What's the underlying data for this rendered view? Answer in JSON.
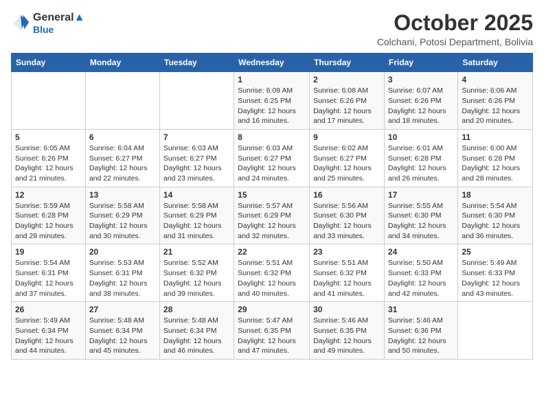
{
  "logo": {
    "line1": "General",
    "line2": "Blue"
  },
  "title": "October 2025",
  "location": "Colchani, Potosi Department, Bolivia",
  "days_of_week": [
    "Sunday",
    "Monday",
    "Tuesday",
    "Wednesday",
    "Thursday",
    "Friday",
    "Saturday"
  ],
  "weeks": [
    [
      {
        "day": "",
        "info": ""
      },
      {
        "day": "",
        "info": ""
      },
      {
        "day": "",
        "info": ""
      },
      {
        "day": "1",
        "info": "Sunrise: 6:09 AM\nSunset: 6:25 PM\nDaylight: 12 hours\nand 16 minutes."
      },
      {
        "day": "2",
        "info": "Sunrise: 6:08 AM\nSunset: 6:26 PM\nDaylight: 12 hours\nand 17 minutes."
      },
      {
        "day": "3",
        "info": "Sunrise: 6:07 AM\nSunset: 6:26 PM\nDaylight: 12 hours\nand 18 minutes."
      },
      {
        "day": "4",
        "info": "Sunrise: 6:06 AM\nSunset: 6:26 PM\nDaylight: 12 hours\nand 20 minutes."
      }
    ],
    [
      {
        "day": "5",
        "info": "Sunrise: 6:05 AM\nSunset: 6:26 PM\nDaylight: 12 hours\nand 21 minutes."
      },
      {
        "day": "6",
        "info": "Sunrise: 6:04 AM\nSunset: 6:27 PM\nDaylight: 12 hours\nand 22 minutes."
      },
      {
        "day": "7",
        "info": "Sunrise: 6:03 AM\nSunset: 6:27 PM\nDaylight: 12 hours\nand 23 minutes."
      },
      {
        "day": "8",
        "info": "Sunrise: 6:03 AM\nSunset: 6:27 PM\nDaylight: 12 hours\nand 24 minutes."
      },
      {
        "day": "9",
        "info": "Sunrise: 6:02 AM\nSunset: 6:27 PM\nDaylight: 12 hours\nand 25 minutes."
      },
      {
        "day": "10",
        "info": "Sunrise: 6:01 AM\nSunset: 6:28 PM\nDaylight: 12 hours\nand 26 minutes."
      },
      {
        "day": "11",
        "info": "Sunrise: 6:00 AM\nSunset: 6:28 PM\nDaylight: 12 hours\nand 28 minutes."
      }
    ],
    [
      {
        "day": "12",
        "info": "Sunrise: 5:59 AM\nSunset: 6:28 PM\nDaylight: 12 hours\nand 29 minutes."
      },
      {
        "day": "13",
        "info": "Sunrise: 5:58 AM\nSunset: 6:29 PM\nDaylight: 12 hours\nand 30 minutes."
      },
      {
        "day": "14",
        "info": "Sunrise: 5:58 AM\nSunset: 6:29 PM\nDaylight: 12 hours\nand 31 minutes."
      },
      {
        "day": "15",
        "info": "Sunrise: 5:57 AM\nSunset: 6:29 PM\nDaylight: 12 hours\nand 32 minutes."
      },
      {
        "day": "16",
        "info": "Sunrise: 5:56 AM\nSunset: 6:30 PM\nDaylight: 12 hours\nand 33 minutes."
      },
      {
        "day": "17",
        "info": "Sunrise: 5:55 AM\nSunset: 6:30 PM\nDaylight: 12 hours\nand 34 minutes."
      },
      {
        "day": "18",
        "info": "Sunrise: 5:54 AM\nSunset: 6:30 PM\nDaylight: 12 hours\nand 36 minutes."
      }
    ],
    [
      {
        "day": "19",
        "info": "Sunrise: 5:54 AM\nSunset: 6:31 PM\nDaylight: 12 hours\nand 37 minutes."
      },
      {
        "day": "20",
        "info": "Sunrise: 5:53 AM\nSunset: 6:31 PM\nDaylight: 12 hours\nand 38 minutes."
      },
      {
        "day": "21",
        "info": "Sunrise: 5:52 AM\nSunset: 6:32 PM\nDaylight: 12 hours\nand 39 minutes."
      },
      {
        "day": "22",
        "info": "Sunrise: 5:51 AM\nSunset: 6:32 PM\nDaylight: 12 hours\nand 40 minutes."
      },
      {
        "day": "23",
        "info": "Sunrise: 5:51 AM\nSunset: 6:32 PM\nDaylight: 12 hours\nand 41 minutes."
      },
      {
        "day": "24",
        "info": "Sunrise: 5:50 AM\nSunset: 6:33 PM\nDaylight: 12 hours\nand 42 minutes."
      },
      {
        "day": "25",
        "info": "Sunrise: 5:49 AM\nSunset: 6:33 PM\nDaylight: 12 hours\nand 43 minutes."
      }
    ],
    [
      {
        "day": "26",
        "info": "Sunrise: 5:49 AM\nSunset: 6:34 PM\nDaylight: 12 hours\nand 44 minutes."
      },
      {
        "day": "27",
        "info": "Sunrise: 5:48 AM\nSunset: 6:34 PM\nDaylight: 12 hours\nand 45 minutes."
      },
      {
        "day": "28",
        "info": "Sunrise: 5:48 AM\nSunset: 6:34 PM\nDaylight: 12 hours\nand 46 minutes."
      },
      {
        "day": "29",
        "info": "Sunrise: 5:47 AM\nSunset: 6:35 PM\nDaylight: 12 hours\nand 47 minutes."
      },
      {
        "day": "30",
        "info": "Sunrise: 5:46 AM\nSunset: 6:35 PM\nDaylight: 12 hours\nand 49 minutes."
      },
      {
        "day": "31",
        "info": "Sunrise: 5:46 AM\nSunset: 6:36 PM\nDaylight: 12 hours\nand 50 minutes."
      },
      {
        "day": "",
        "info": ""
      }
    ]
  ]
}
